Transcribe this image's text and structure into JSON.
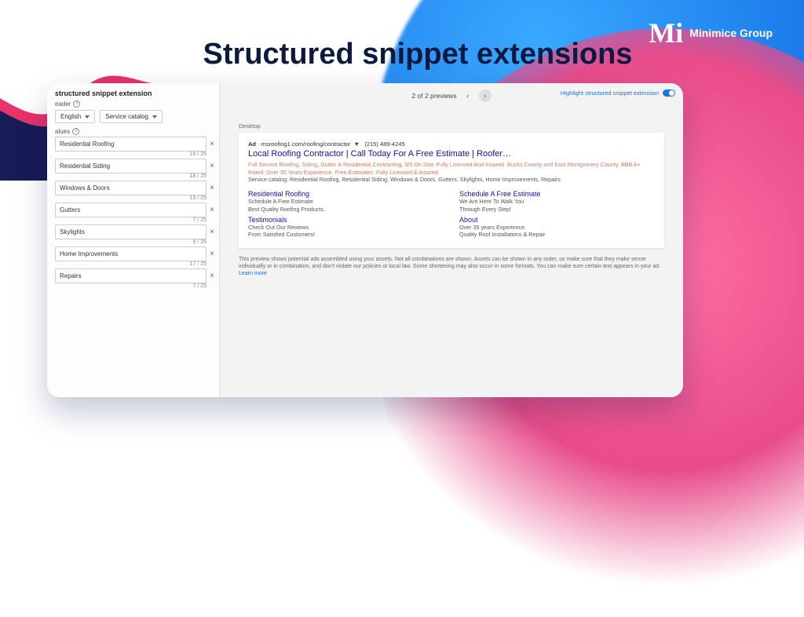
{
  "brand": {
    "name": "Minimice Group"
  },
  "title": "Structured snippet extensions",
  "left": {
    "section_title": "structured snippet extension",
    "header_label": "eader",
    "language": "English",
    "type": "Service catalog",
    "values_label": "alues",
    "values": [
      {
        "text": "Residential Roofing",
        "count": "19 / 25"
      },
      {
        "text": "Residential Siding",
        "count": "18 / 25"
      },
      {
        "text": "Windows & Doors",
        "count": "15 / 25"
      },
      {
        "text": "Gutters",
        "count": "7 / 25"
      },
      {
        "text": "Skylights",
        "count": "9 / 25"
      },
      {
        "text": "Home Improvements",
        "count": "17 / 25"
      },
      {
        "text": "Repairs",
        "count": "7 / 25"
      }
    ]
  },
  "preview": {
    "counter": "2 of 2 previews",
    "highlight_label": "Highlight structured snippet extension",
    "device_label": "Desktop",
    "ad": {
      "tag": "Ad",
      "url": "msroofing1.com/roofing/contractor",
      "phone": "(215) 489-4245",
      "headline": "Local Roofing Contractor | Call Today For A Free Estimate | Roofer…",
      "desc1": "Full Service Roofing, Siding, Gutter & Residential Contracting. 5/5 On Star. Fully Licensed And Insured. Bucks County and East Montgomery County. BBB A+ Rated. Over 35 Years Experience. Free Estimates. Fully Licensed & Insured.",
      "desc2": "Service catalog: Residential Roofing, Residential Siding, Windows & Doors, Gutters, Skylights, Home Improvements, Repairs",
      "links": [
        {
          "title": "Residential Roofing",
          "l1": "Schedule A Free Estimate.",
          "l2": "Best Quality Roofing Products."
        },
        {
          "title": "Schedule A Free Estimate",
          "l1": "We Are Here To Walk You",
          "l2": "Through Every Step!"
        },
        {
          "title": "Testimonials",
          "l1": "Check Out Our Reviews",
          "l2": "From Satisfied Customers!"
        },
        {
          "title": "About",
          "l1": "Over 35 years Experience",
          "l2": "Quality Roof Installations & Repair"
        }
      ]
    },
    "disclaimer": "This preview shows potential ads assembled using your assets. Not all combinations are shown. Assets can be shown in any order, so make sure that they make sense individually or in combination, and don't violate our policies or local law. Some shortening may also occur in some formats. You can make sure certain text appears in your ad.",
    "learn": "Learn more"
  }
}
